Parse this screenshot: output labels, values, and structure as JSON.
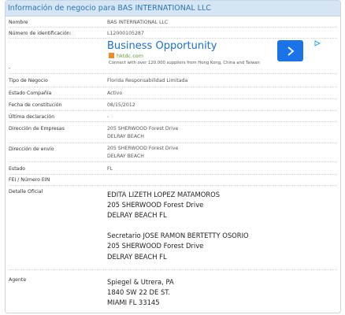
{
  "header": {
    "title": "Información de negocio para BAS INTERNATIONAL LLC"
  },
  "ad": {
    "title": "Business Opportunity",
    "site": "hktdc.com",
    "description": "Connect with over 120,000 suppliers from Hong Kong, China and Taiwan",
    "button_icon": "chevron-right-icon",
    "choices_icon": "ad-choices-icon"
  },
  "fields": {
    "nombre": {
      "label": "Nombre",
      "value": "BAS INTERNATIONAL LLC"
    },
    "numero": {
      "label": "Número de identificación:",
      "value": "L12000105287"
    },
    "blank": {
      "label": "-"
    },
    "tipo": {
      "label": "Tipo de Negocio",
      "value": "Florida Responsabilidad Limitada"
    },
    "estado_compania": {
      "label": "Estado Compañía",
      "value": "Activo"
    },
    "fecha": {
      "label": "Fecha de constitución",
      "value": "08/15/2012"
    },
    "ultima": {
      "label": "Última declaración",
      "value": "-"
    },
    "direccion_empresas": {
      "label": "Dirección de Empresas",
      "line1": "205 SHERWOOD Forest Drive",
      "line2": "DELRAY BEACH"
    },
    "direccion_envio": {
      "label": "Dirección de envío",
      "line1": "205 SHERWOOD Forest Drive",
      "line2": "DELRAY BEACH"
    },
    "estado": {
      "label": "Estado",
      "value": "FL"
    },
    "fei": {
      "label": "FEI / Número EIN"
    },
    "detalle": {
      "label": "Detalle Oficial",
      "officer1": [
        "EDITA LIZETH LOPEZ MATAMOROS",
        "205 SHERWOOD Forest Drive",
        "DELRAY BEACH FL"
      ],
      "officer2": [
        "Secretario JOSE RAMON BERTETTY OSORIO",
        "205 SHERWOOD Forest Drive",
        "DELRAY BEACH FL"
      ]
    },
    "agente": {
      "label": "Agente",
      "lines": [
        "Spiegel & Utrera, PA",
        "1840 SW 22 DE ST.",
        "MIAMI FL 33145"
      ]
    }
  },
  "colors": {
    "header_bg": "#d6e5f3",
    "header_text": "#2a77b3",
    "ad_button": "#1a73e8",
    "ad_title": "#1a6fd8"
  }
}
